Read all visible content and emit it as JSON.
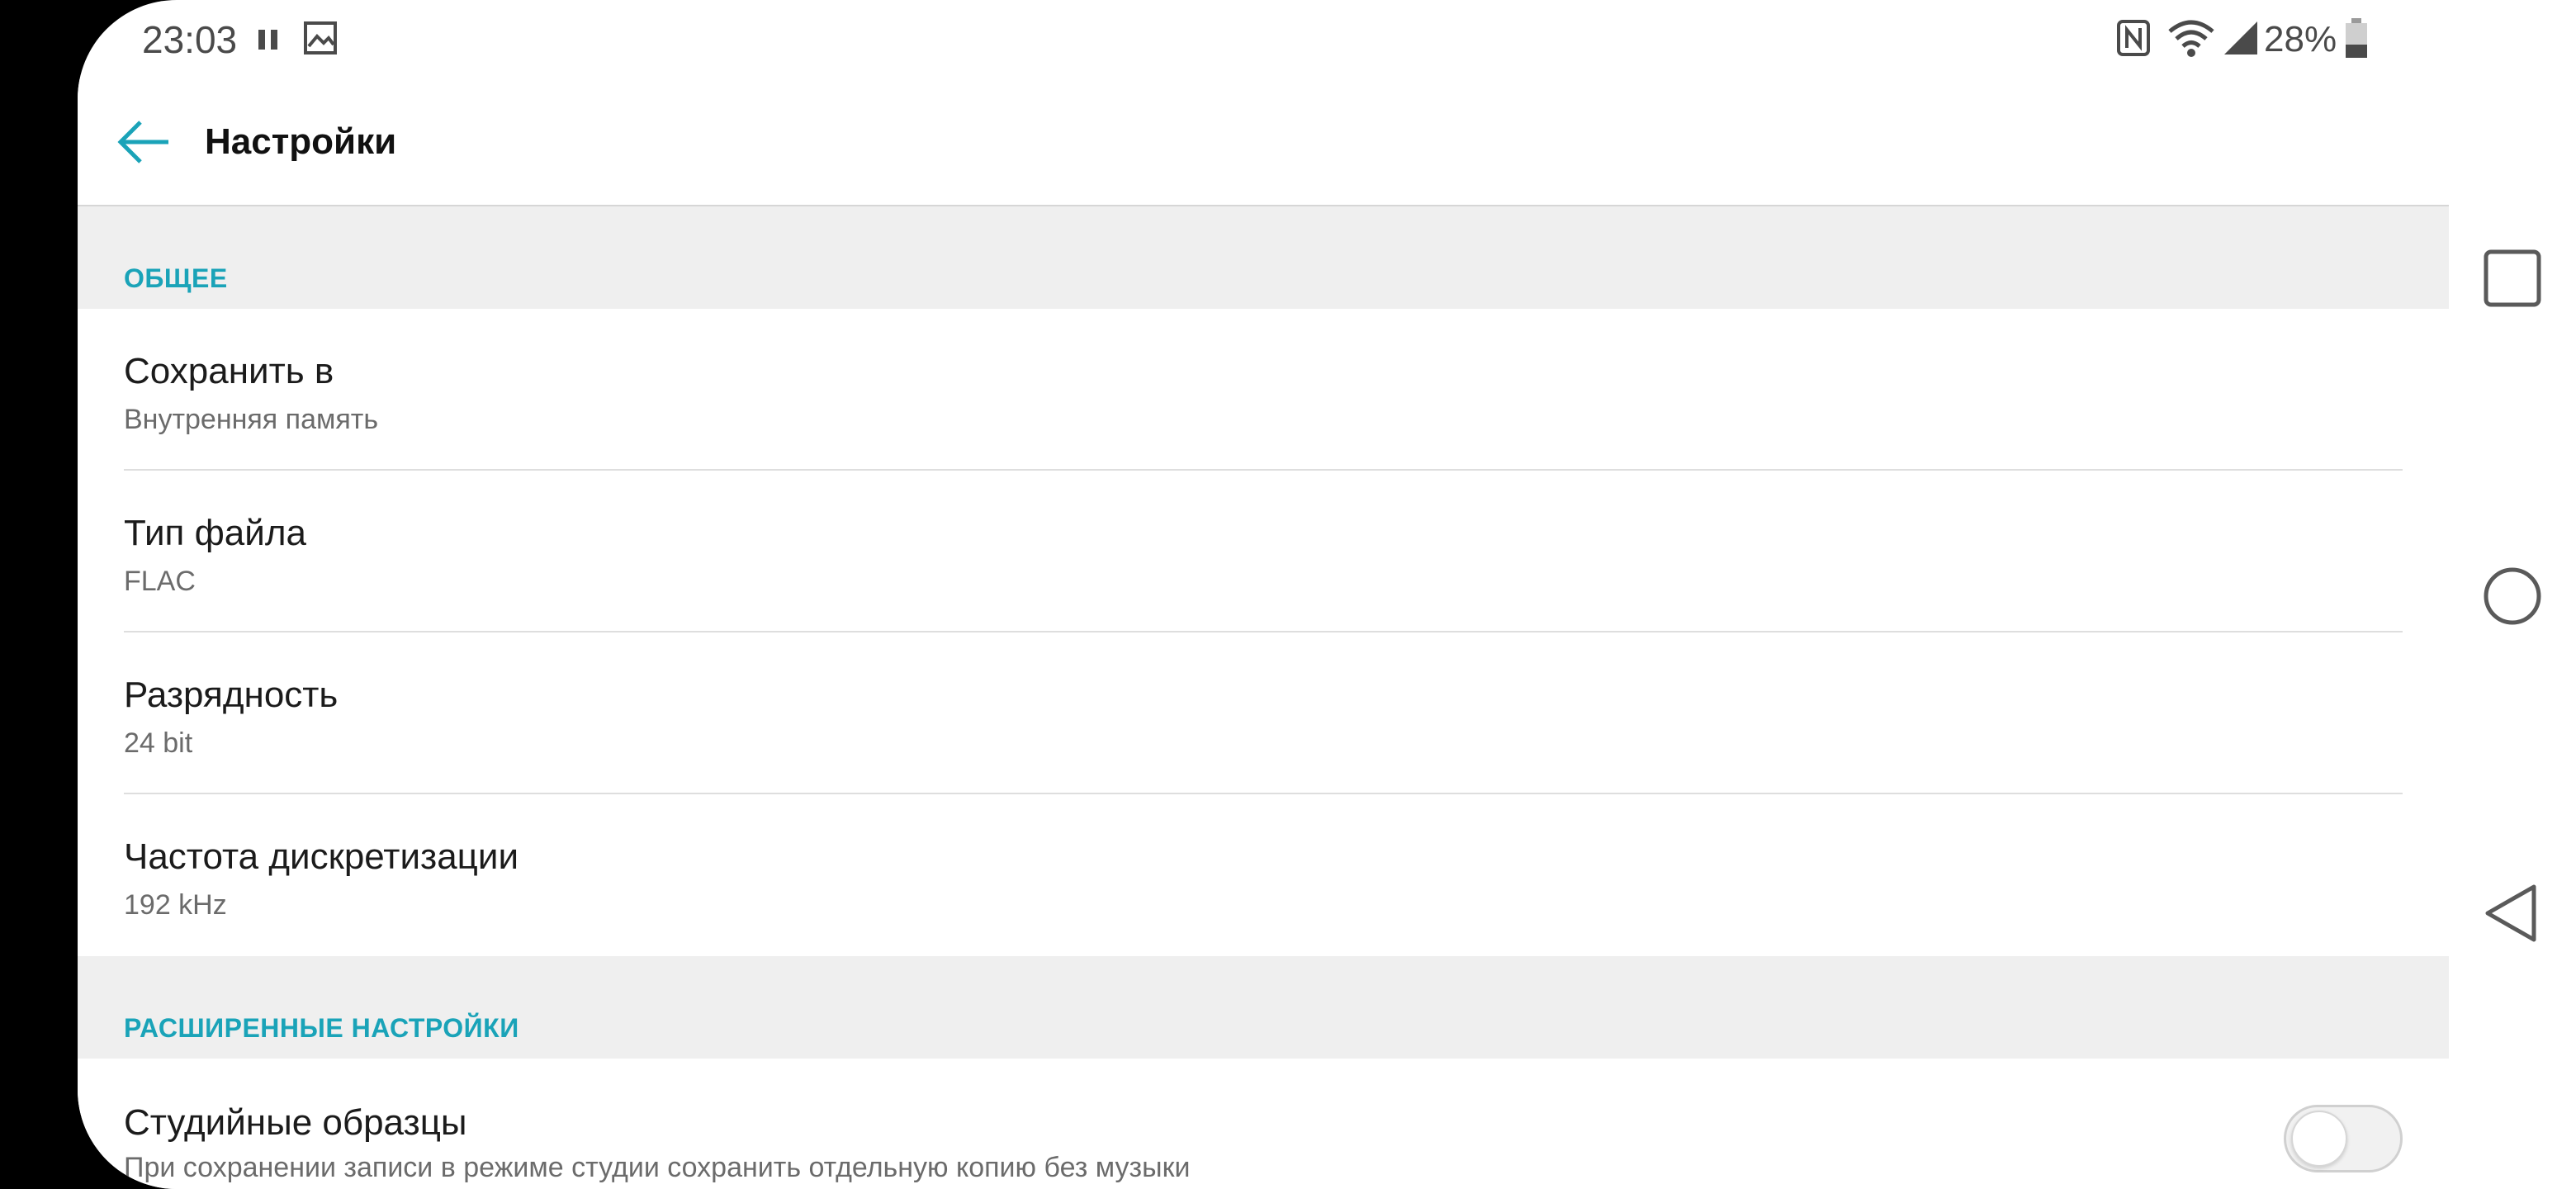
{
  "status_bar": {
    "time": "23:03",
    "icons": [
      "pause-icon",
      "image-icon",
      "nfc-icon",
      "wifi-icon",
      "signal-icon",
      "battery-icon"
    ],
    "battery_percent": "28%",
    "battery_level": 0.28
  },
  "app_bar": {
    "title": "Настройки",
    "back_icon": "arrow-back-icon"
  },
  "sections": {
    "general": {
      "header": "ОБЩЕЕ",
      "items": [
        {
          "title": "Сохранить в",
          "summary": "Внутренняя память"
        },
        {
          "title": "Тип файла",
          "summary": "FLAC"
        },
        {
          "title": "Разрядность",
          "summary": "24 bit"
        },
        {
          "title": "Частота дискретизации",
          "summary": "192 kHz"
        }
      ]
    },
    "advanced": {
      "header": "РАСШИРЕННЫЕ НАСТРОЙКИ",
      "items": [
        {
          "title": "Студийные образцы",
          "summary": "При сохранении записи в режиме студии сохранить отдельную копию без музыки",
          "switch_on": false
        }
      ]
    }
  },
  "nav_bar": {
    "buttons": [
      "recents-square-icon",
      "home-circle-icon",
      "back-triangle-icon"
    ]
  },
  "colors": {
    "accent": "#1aa3b8",
    "section_bg": "#efefef"
  }
}
